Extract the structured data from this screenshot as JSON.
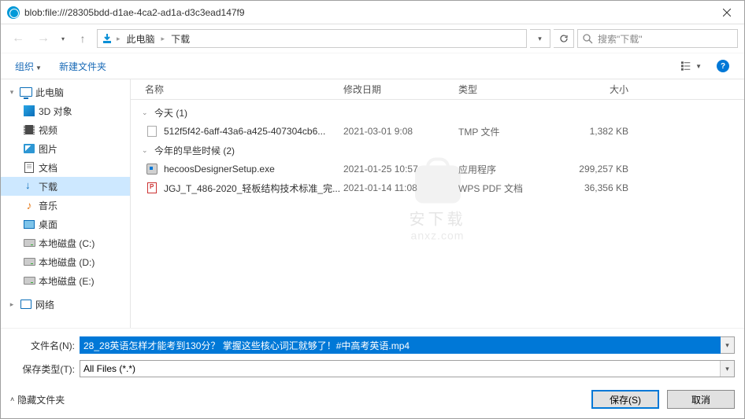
{
  "window": {
    "title": "blob:file:///28305bdd-d1ae-4ca2-ad1a-d3c3ead147f9"
  },
  "breadcrumb": {
    "root": "此电脑",
    "current": "下载"
  },
  "search": {
    "placeholder": "搜索\"下载\""
  },
  "toolbar": {
    "organize": "组织",
    "new_folder": "新建文件夹"
  },
  "sidebar": {
    "this_pc": "此电脑",
    "objects_3d": "3D 对象",
    "videos": "视频",
    "pictures": "图片",
    "documents": "文档",
    "downloads": "下载",
    "music": "音乐",
    "desktop": "桌面",
    "local_c": "本地磁盘 (C:)",
    "local_d": "本地磁盘 (D:)",
    "local_e": "本地磁盘 (E:)",
    "network": "网络"
  },
  "columns": {
    "name": "名称",
    "modified": "修改日期",
    "type": "类型",
    "size": "大小"
  },
  "groups": {
    "today": "今天 (1)",
    "earlier": "今年的早些时候 (2)"
  },
  "files": [
    {
      "name": "512f5f42-6aff-43a6-a425-407304cb6...",
      "mod": "2021-03-01 9:08",
      "type": "TMP 文件",
      "size": "1,382 KB",
      "icon": "generic"
    },
    {
      "name": "hecoosDesignerSetup.exe",
      "mod": "2021-01-25 10:57",
      "type": "应用程序",
      "size": "299,257 KB",
      "icon": "exe"
    },
    {
      "name": "JGJ_T_486-2020_轻板结构技术标准_完...",
      "mod": "2021-01-14 11:08",
      "type": "WPS PDF 文档",
      "size": "36,356 KB",
      "icon": "pdf"
    }
  ],
  "watermark": {
    "line1": "安下载",
    "line2": "anxz.com"
  },
  "form": {
    "filename_label": "文件名(N):",
    "filename_value": "28_28英语怎样才能考到130分？ 掌握这些核心词汇就够了！#中高考英语.mp4",
    "type_label": "保存类型(T):",
    "type_value": "All Files (*.*)"
  },
  "footer": {
    "hide_folders": "隐藏文件夹",
    "save": "保存(S)",
    "cancel": "取消"
  }
}
